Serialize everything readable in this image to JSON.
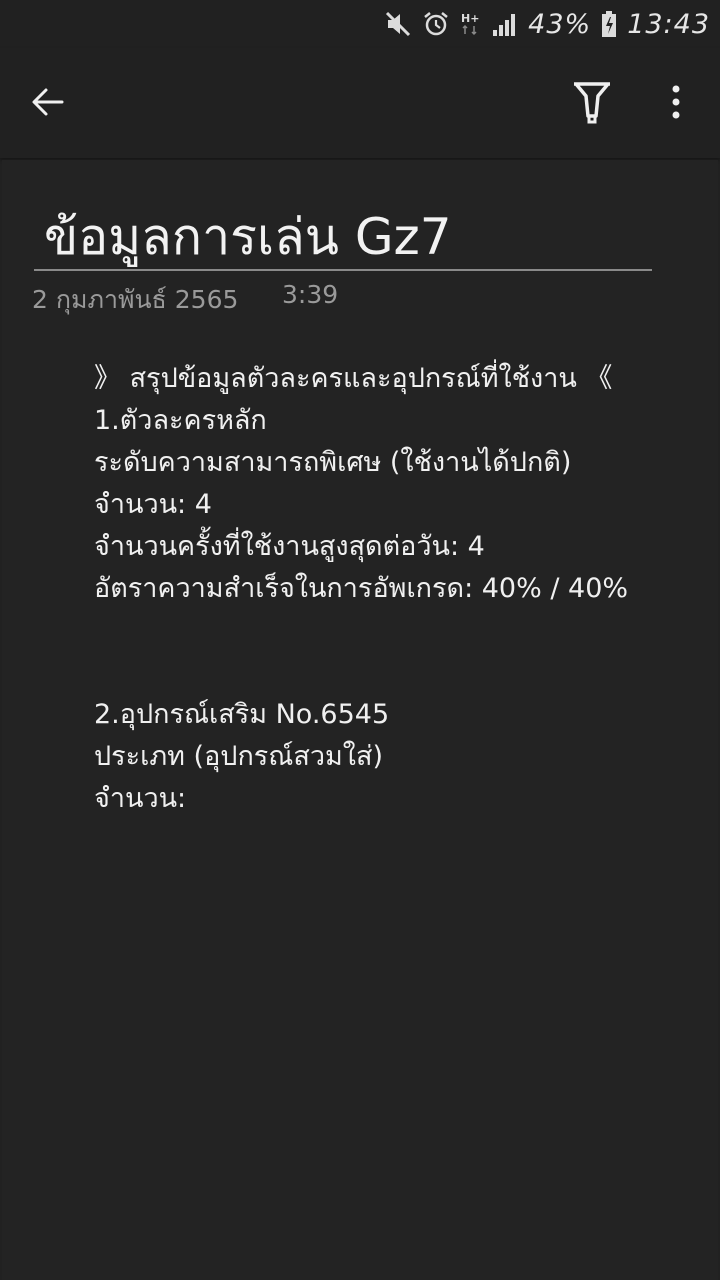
{
  "status_bar": {
    "battery": "43%",
    "time": "13:43",
    "icons": [
      "mute-icon",
      "alarm-icon",
      "hplus-network-icon",
      "signal-icon",
      "battery-charging-icon"
    ]
  },
  "app_bar": {
    "back_icon": "arrow-left-icon",
    "pen_icon": "pen-icon",
    "more_icon": "more-vert-icon"
  },
  "note": {
    "title": "ข้อมูลการเล่น Gz7",
    "date": "2 กุมภาพันธ์ 2565",
    "time": "3:39",
    "lines": [
      "》 สรุปข้อมูลตัวละครและอุปกรณ์ที่ใช้งาน 《",
      "1.ตัวละครหลัก",
      "ระดับความสามารถพิเศษ (ใช้งานได้ปกติ)",
      "จำนวน: 4",
      "จำนวนครั้งที่ใช้งานสูงสุดต่อวัน: 4",
      "อัตราความสำเร็จในการอัพเกรด: 40% / 40%",
      "",
      "2.อุปกรณ์เสริม No.6545",
      "ประเภท (อุปกรณ์สวมใส่)",
      "จำนวน:"
    ]
  }
}
